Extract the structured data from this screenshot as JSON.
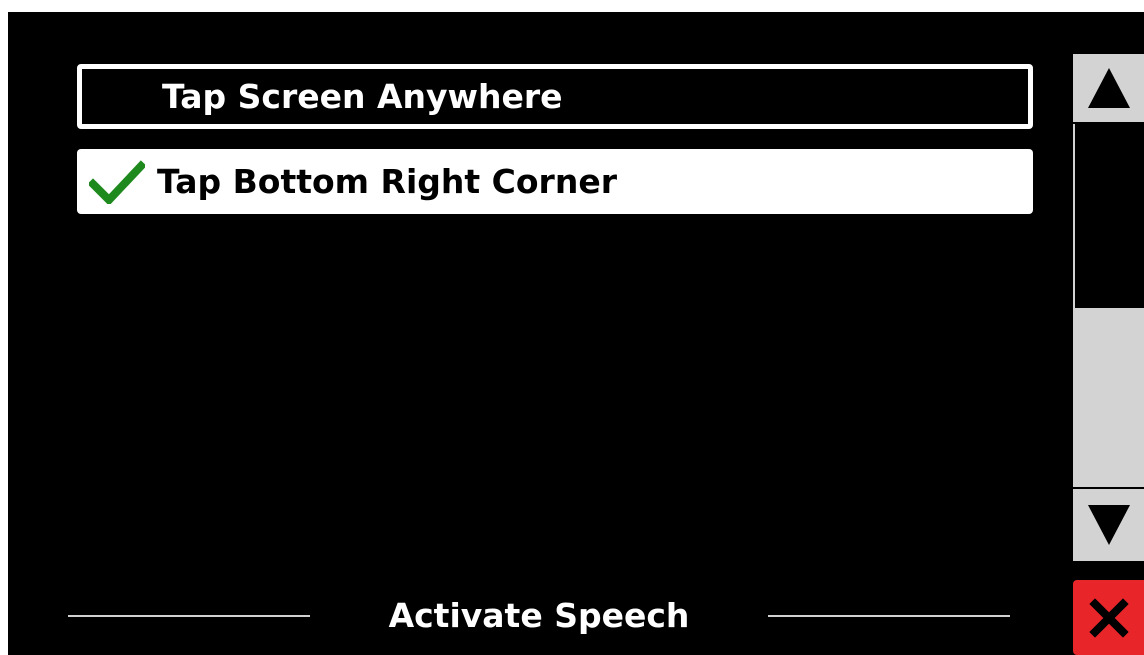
{
  "options": [
    {
      "label": "Tap Screen Anywhere",
      "selected": false
    },
    {
      "label": "Tap Bottom Right Corner",
      "selected": true
    }
  ],
  "icons": {
    "selected_check": "checkmark-icon",
    "scroll_up": "triangle-up-icon",
    "scroll_down": "triangle-down-icon",
    "close": "close-icon"
  },
  "colors": {
    "background": "#000000",
    "option_selected_bg": "#ffffff",
    "check": "#1e8a1e",
    "scrollbar": "#d3d3d3",
    "close_button": "#e8262a"
  },
  "scrollbar": {
    "thumb_position_fraction": 0.5
  },
  "footer": {
    "title": "Activate Speech"
  }
}
